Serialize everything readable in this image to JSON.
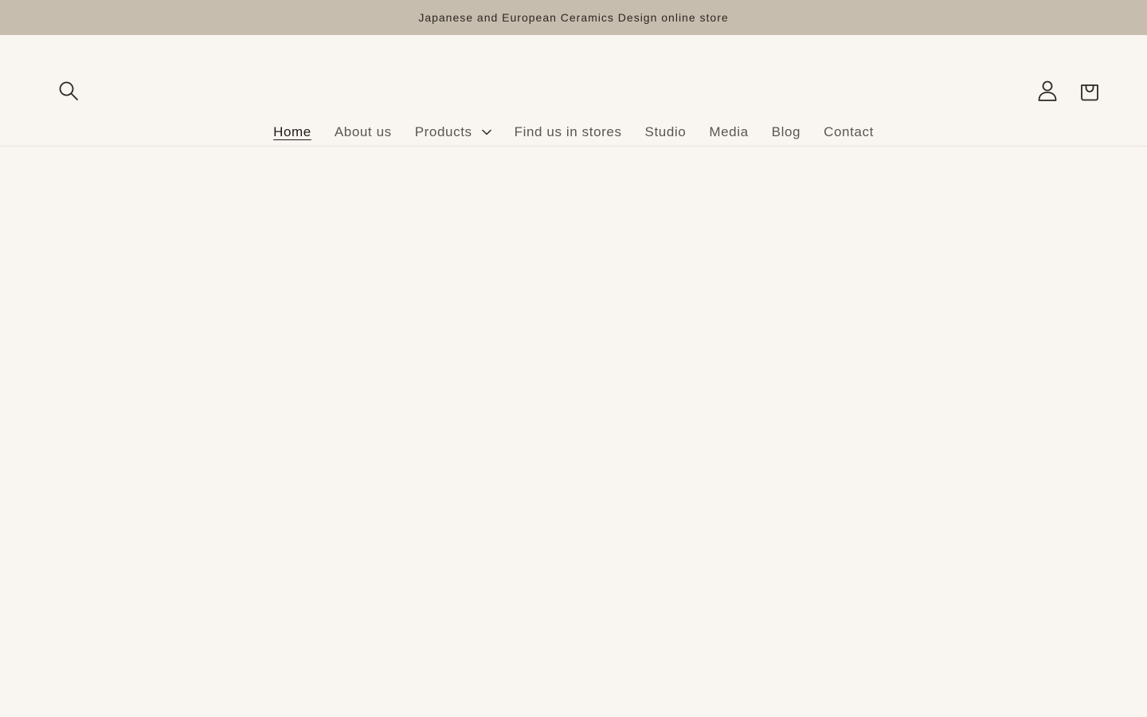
{
  "announcement": {
    "text": "Japanese and European Ceramics Design online store"
  },
  "header": {
    "search_icon": "search-icon",
    "account_icon": "user-icon",
    "cart_icon": "cart-icon"
  },
  "nav": {
    "items": [
      {
        "label": "Home",
        "active": true
      },
      {
        "label": "About us"
      },
      {
        "label": "Products",
        "has_dropdown": true,
        "dropdown_icon": "chevron-down-icon"
      },
      {
        "label": "Find us in stores"
      },
      {
        "label": "Studio"
      },
      {
        "label": "Media"
      },
      {
        "label": "Blog"
      },
      {
        "label": "Contact"
      }
    ]
  },
  "colors": {
    "announcement_bg": "#c7bdae",
    "page_bg": "#f9f5f1",
    "text_active": "#1f1c19",
    "text_nav": "#5a5650"
  }
}
